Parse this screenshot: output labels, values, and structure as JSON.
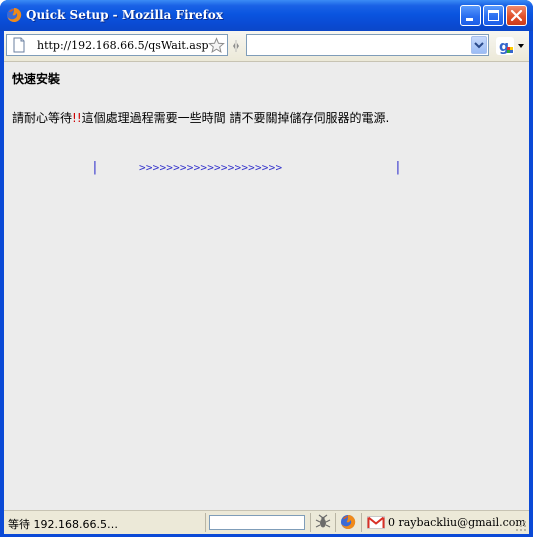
{
  "window": {
    "title": "Quick Setup - Mozilla Firefox",
    "title_color": "#0a49d6"
  },
  "toolbar": {
    "url": "http://192.168.66.5/qsWait.asp",
    "search_value": ""
  },
  "page": {
    "heading": "快速安裝",
    "message_before": "請耐心等待",
    "message_exclaim": "!!",
    "message_after": "這個處理過程需要一些時間 請不要關掉儲存伺服器的電源.",
    "bar_left": "|",
    "progress_arrows": ">>>>>>>>>>>>>>>>>>>>>",
    "bar_right": "|",
    "progress_color": "#3333cc"
  },
  "statusbar": {
    "status": "等待 192.168.66.5…",
    "field_value": "",
    "gmail_text": "0 raybackliu@gmail.com"
  },
  "icons": [
    "firefox-icon",
    "page-icon",
    "star-icon",
    "google-icon",
    "firebug-icon",
    "gmail-icon",
    "minimize-icon",
    "maximize-icon",
    "close-icon"
  ]
}
